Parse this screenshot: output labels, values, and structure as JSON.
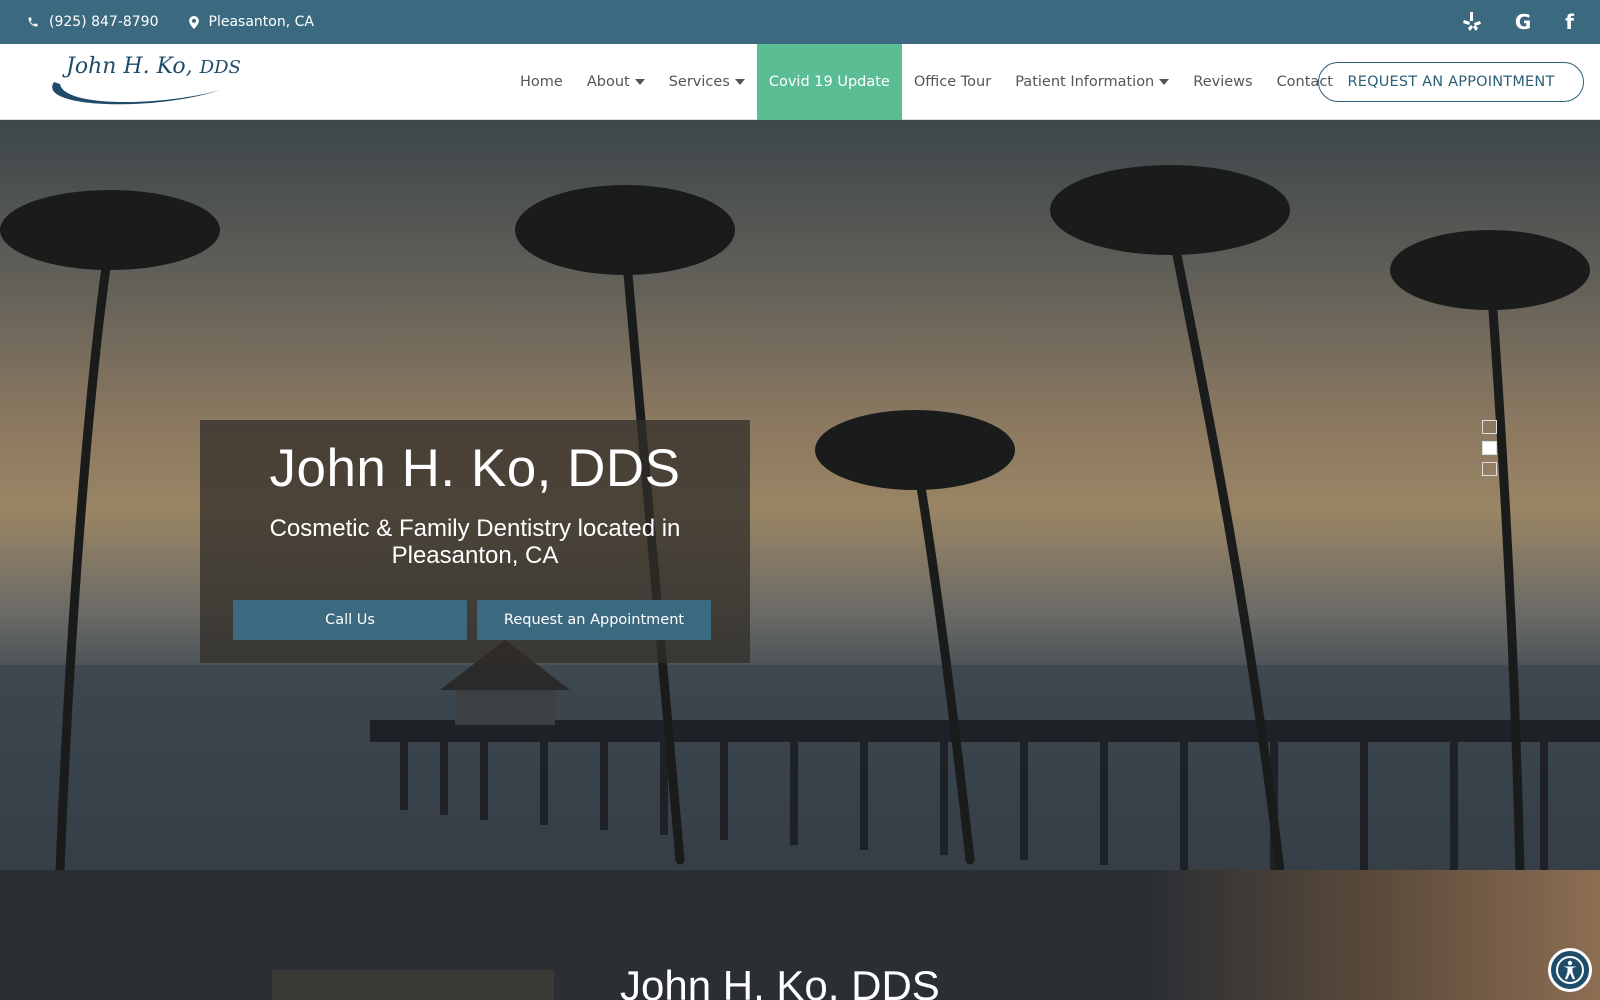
{
  "topbar": {
    "phone": "(925) 847-8790",
    "location": "Pleasanton, CA",
    "social": [
      "yelp-icon",
      "google-icon",
      "facebook-icon"
    ],
    "google_glyph": "G",
    "facebook_glyph": "f"
  },
  "header": {
    "logo_name": "John H. Ko,",
    "logo_suffix": "DDS",
    "nav": {
      "home": "Home",
      "about": "About",
      "services": "Services",
      "covid": "Covid 19 Update",
      "office_tour": "Office Tour",
      "patient_info": "Patient Information",
      "reviews": "Reviews",
      "contact": "Contact"
    },
    "request_label": "REQUEST AN APPOINTMENT"
  },
  "hero": {
    "title": "John H. Ko, DDS",
    "subtitle_line1": "Cosmetic & Family Dentistry located in",
    "subtitle_line2": "Pleasanton, CA",
    "call_label": "Call Us",
    "appointment_label": "Request an Appointment",
    "slide_active": 2,
    "slide_count": 3
  },
  "about": {
    "heading": "John H. Ko, DDS"
  },
  "colors": {
    "primary": "#3b6a80",
    "accent": "#5bbd93",
    "logo": "#1f4c69"
  }
}
